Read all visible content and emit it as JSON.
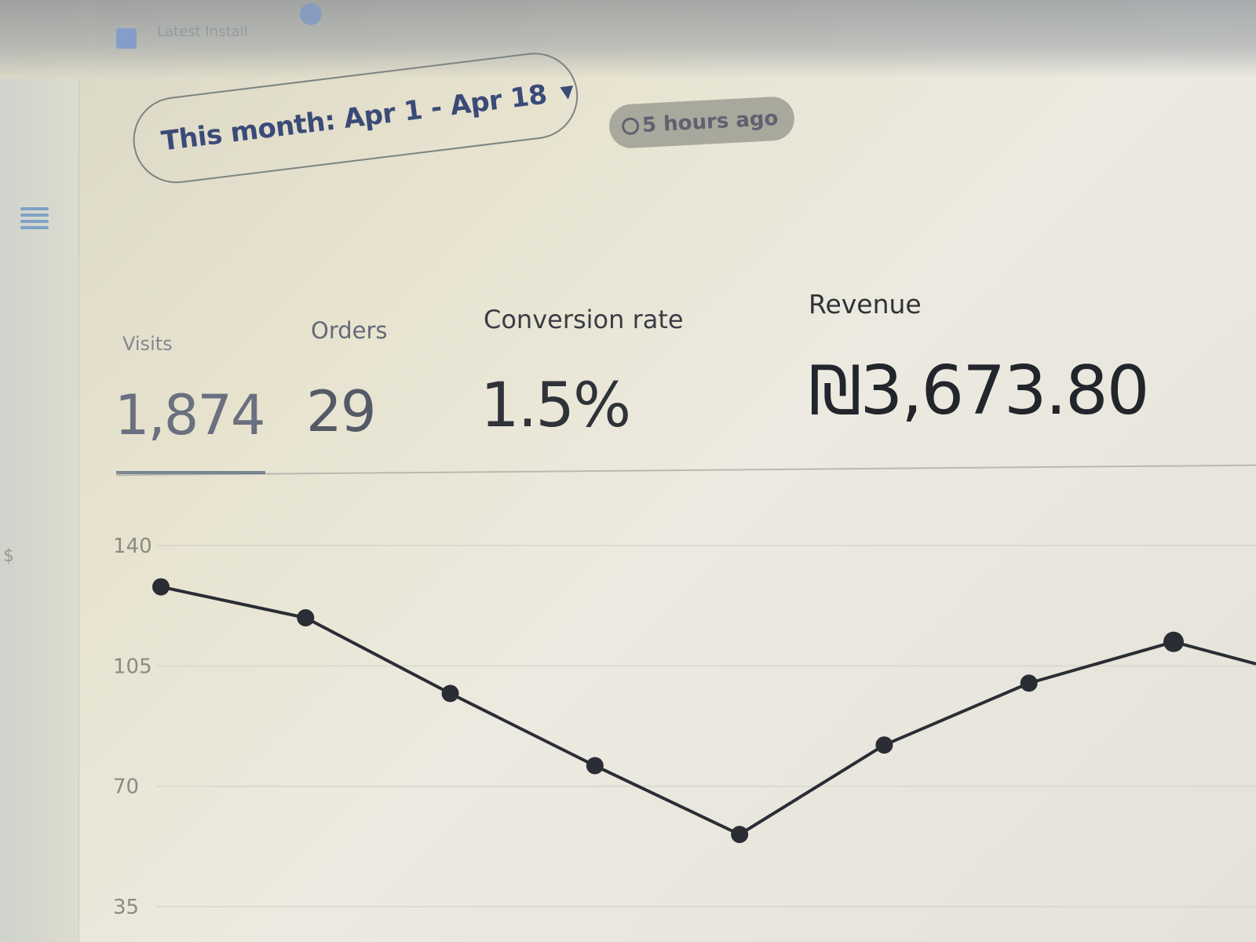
{
  "topbar": {
    "label": "Latest Install"
  },
  "date_range": {
    "label": "This month: Apr 1 - Apr 18",
    "caret": "▼"
  },
  "updated": {
    "text": "5 hours ago"
  },
  "metrics": [
    {
      "key": "visits",
      "label": "Visits",
      "value": "1,874"
    },
    {
      "key": "orders",
      "label": "Orders",
      "value": "29"
    },
    {
      "key": "conversion",
      "label": "Conversion rate",
      "value": "1.5%"
    },
    {
      "key": "revenue",
      "label": "Revenue",
      "value": "₪3,673.80"
    }
  ],
  "chart_data": {
    "type": "line",
    "title": "",
    "xlabel": "",
    "ylabel": "",
    "y_ticks": [
      "140",
      "105",
      "70",
      "35"
    ],
    "ylim": [
      35,
      140
    ],
    "x": [
      1,
      2,
      3,
      4,
      5,
      6,
      7,
      8
    ],
    "series": [
      {
        "values": [
          128,
          119,
          97,
          76,
          56,
          82,
          100,
          112
        ]
      }
    ],
    "grid": true,
    "legend": "none",
    "line_color": "#2a2d33"
  }
}
